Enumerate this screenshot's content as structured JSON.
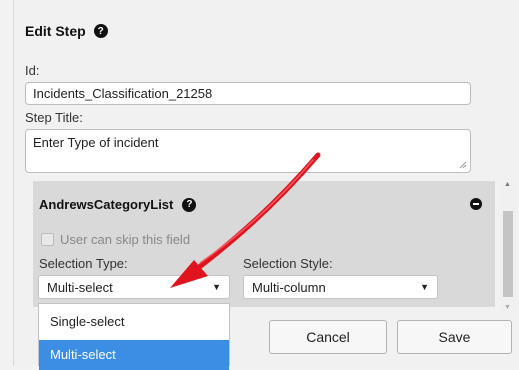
{
  "dialog": {
    "title": "Edit Step",
    "help_icon": "question-circle-icon"
  },
  "id_field": {
    "label": "Id:",
    "value": "Incidents_Classification_21258"
  },
  "step_title_field": {
    "label": "Step Title:",
    "value": "Enter Type of incident"
  },
  "category_section": {
    "title": "AndrewsCategoryList",
    "help_icon": "question-circle-icon",
    "remove_icon": "minus-circle-icon",
    "skip_checkbox_label": "User can skip this field",
    "skip_checked": false,
    "selection_type": {
      "label": "Selection Type:",
      "value": "Multi-select",
      "options": [
        "Single-select",
        "Multi-select"
      ]
    },
    "selection_style": {
      "label": "Selection Style:",
      "value": "Multi-column"
    }
  },
  "buttons": {
    "cancel": "Cancel",
    "save": "Save"
  },
  "colors": {
    "highlight": "#3b8ee4",
    "annotation_arrow": "#e0141e"
  }
}
